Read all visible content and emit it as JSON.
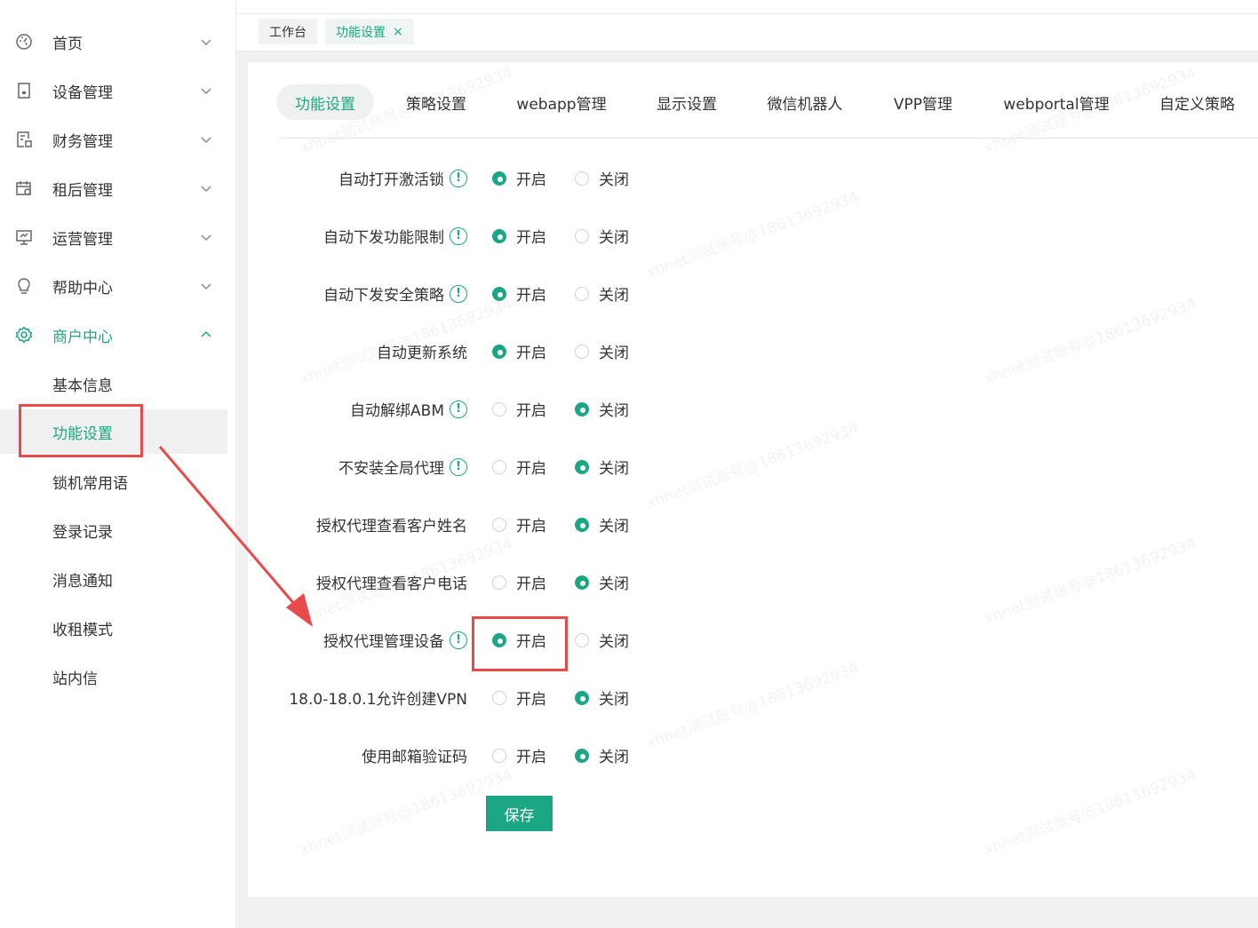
{
  "sidebar": {
    "menu": [
      {
        "label": "首页",
        "icon": "dashboard-icon"
      },
      {
        "label": "设备管理",
        "icon": "device-icon"
      },
      {
        "label": "财务管理",
        "icon": "finance-icon"
      },
      {
        "label": "租后管理",
        "icon": "calendar-icon"
      },
      {
        "label": "运营管理",
        "icon": "monitor-icon"
      },
      {
        "label": "帮助中心",
        "icon": "bulb-icon"
      },
      {
        "label": "商户中心",
        "icon": "gear-icon"
      }
    ],
    "sub_items": [
      "基本信息",
      "功能设置",
      "锁机常用语",
      "登录记录",
      "消息通知",
      "收租模式",
      "站内信"
    ],
    "active_sub": "功能设置"
  },
  "page_tabs": {
    "workbench": "工作台",
    "feature_settings": "功能设置",
    "close_symbol": "×"
  },
  "settings_tabs": [
    "功能设置",
    "策略设置",
    "webapp管理",
    "显示设置",
    "微信机器人",
    "VPP管理",
    "webportal管理",
    "自定义策略"
  ],
  "radio_labels": {
    "on": "开启",
    "off": "关闭"
  },
  "settings": [
    {
      "label": "自动打开激活锁",
      "info": true,
      "value": "on"
    },
    {
      "label": "自动下发功能限制",
      "info": true,
      "value": "on"
    },
    {
      "label": "自动下发安全策略",
      "info": true,
      "value": "on"
    },
    {
      "label": "自动更新系统",
      "info": false,
      "value": "on"
    },
    {
      "label": "自动解绑ABM",
      "info": true,
      "value": "off"
    },
    {
      "label": "不安装全局代理",
      "info": true,
      "value": "off"
    },
    {
      "label": "授权代理查看客户姓名",
      "info": false,
      "value": "off"
    },
    {
      "label": "授权代理查看客户电话",
      "info": false,
      "value": "off"
    },
    {
      "label": "授权代理管理设备",
      "info": true,
      "value": "on"
    },
    {
      "label": "18.0-18.0.1允许创建VPN",
      "info": false,
      "value": "off"
    },
    {
      "label": "使用邮箱验证码",
      "info": false,
      "value": "off"
    }
  ],
  "save_label": "保存",
  "info_glyph": "!",
  "watermark": "xhnet测试账号@18613692934",
  "colors": {
    "accent": "#1ba784",
    "annotation": "#e84a4a"
  }
}
